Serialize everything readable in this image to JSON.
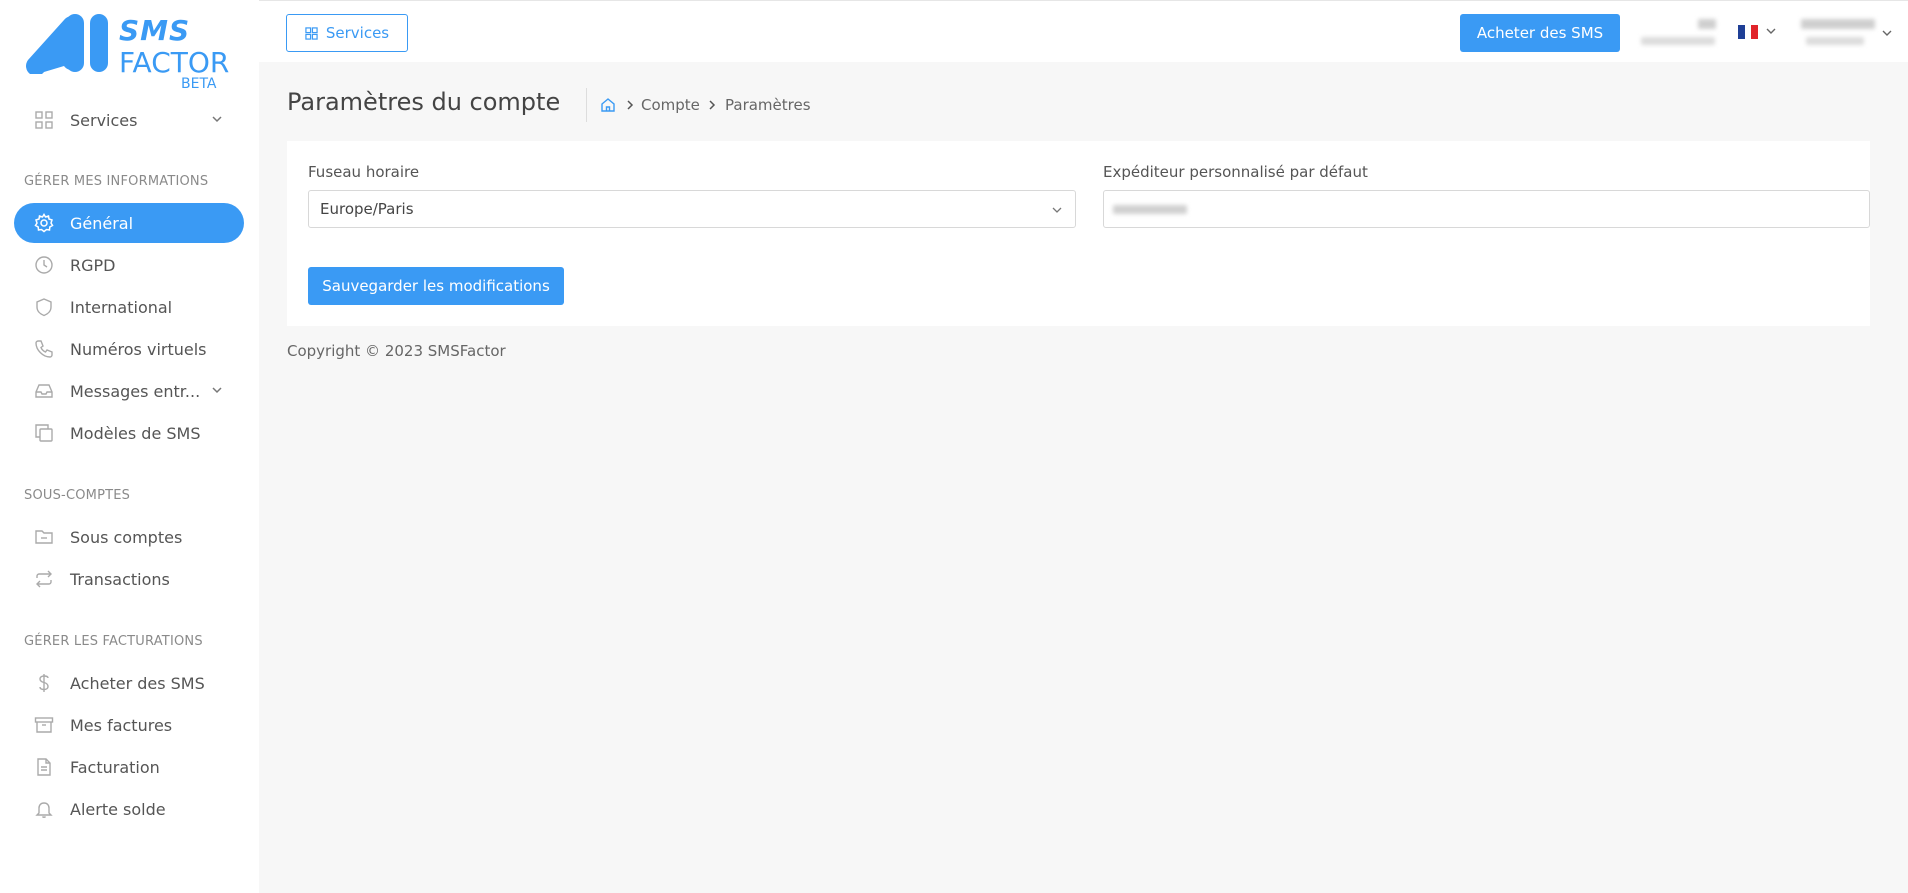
{
  "brand": {
    "line1": "SMS",
    "line2": "FACTOR",
    "badge": "BETA",
    "color": "#3a9af4"
  },
  "topbar": {
    "services_label": "Services",
    "buy_label": "Acheter des SMS",
    "language_flag": "flag-fr"
  },
  "sidebar": {
    "services": {
      "label": "Services",
      "icon": "grid-icon"
    },
    "sections": [
      {
        "title": "GÉRER MES INFORMATIONS",
        "items": [
          {
            "label": "Général",
            "icon": "gear-icon",
            "active": true
          },
          {
            "label": "RGPD",
            "icon": "clock-icon"
          },
          {
            "label": "International",
            "icon": "shield-icon"
          },
          {
            "label": "Numéros virtuels",
            "icon": "phone-icon"
          },
          {
            "label": "Messages entr...",
            "icon": "inbox-icon",
            "expandable": true
          },
          {
            "label": "Modèles de SMS",
            "icon": "copy-icon"
          }
        ]
      },
      {
        "title": "SOUS-COMPTES",
        "items": [
          {
            "label": "Sous comptes",
            "icon": "folder-icon"
          },
          {
            "label": "Transactions",
            "icon": "repeat-icon"
          }
        ]
      },
      {
        "title": "GÉRER LES FACTURATIONS",
        "items": [
          {
            "label": "Acheter des SMS",
            "icon": "dollar-icon"
          },
          {
            "label": "Mes factures",
            "icon": "archive-icon"
          },
          {
            "label": "Facturation",
            "icon": "file-icon"
          },
          {
            "label": "Alerte solde",
            "icon": "bell-icon"
          }
        ]
      }
    ]
  },
  "page": {
    "title": "Paramètres du compte",
    "breadcrumb": [
      "Compte",
      "Paramètres"
    ]
  },
  "form": {
    "timezone_label": "Fuseau horaire",
    "timezone_value": "Europe/Paris",
    "sender_label": "Expéditeur personnalisé par défaut",
    "save_label": "Sauvegarder les modifications"
  },
  "footer": {
    "copyright": "Copyright © 2023 SMSFactor"
  }
}
